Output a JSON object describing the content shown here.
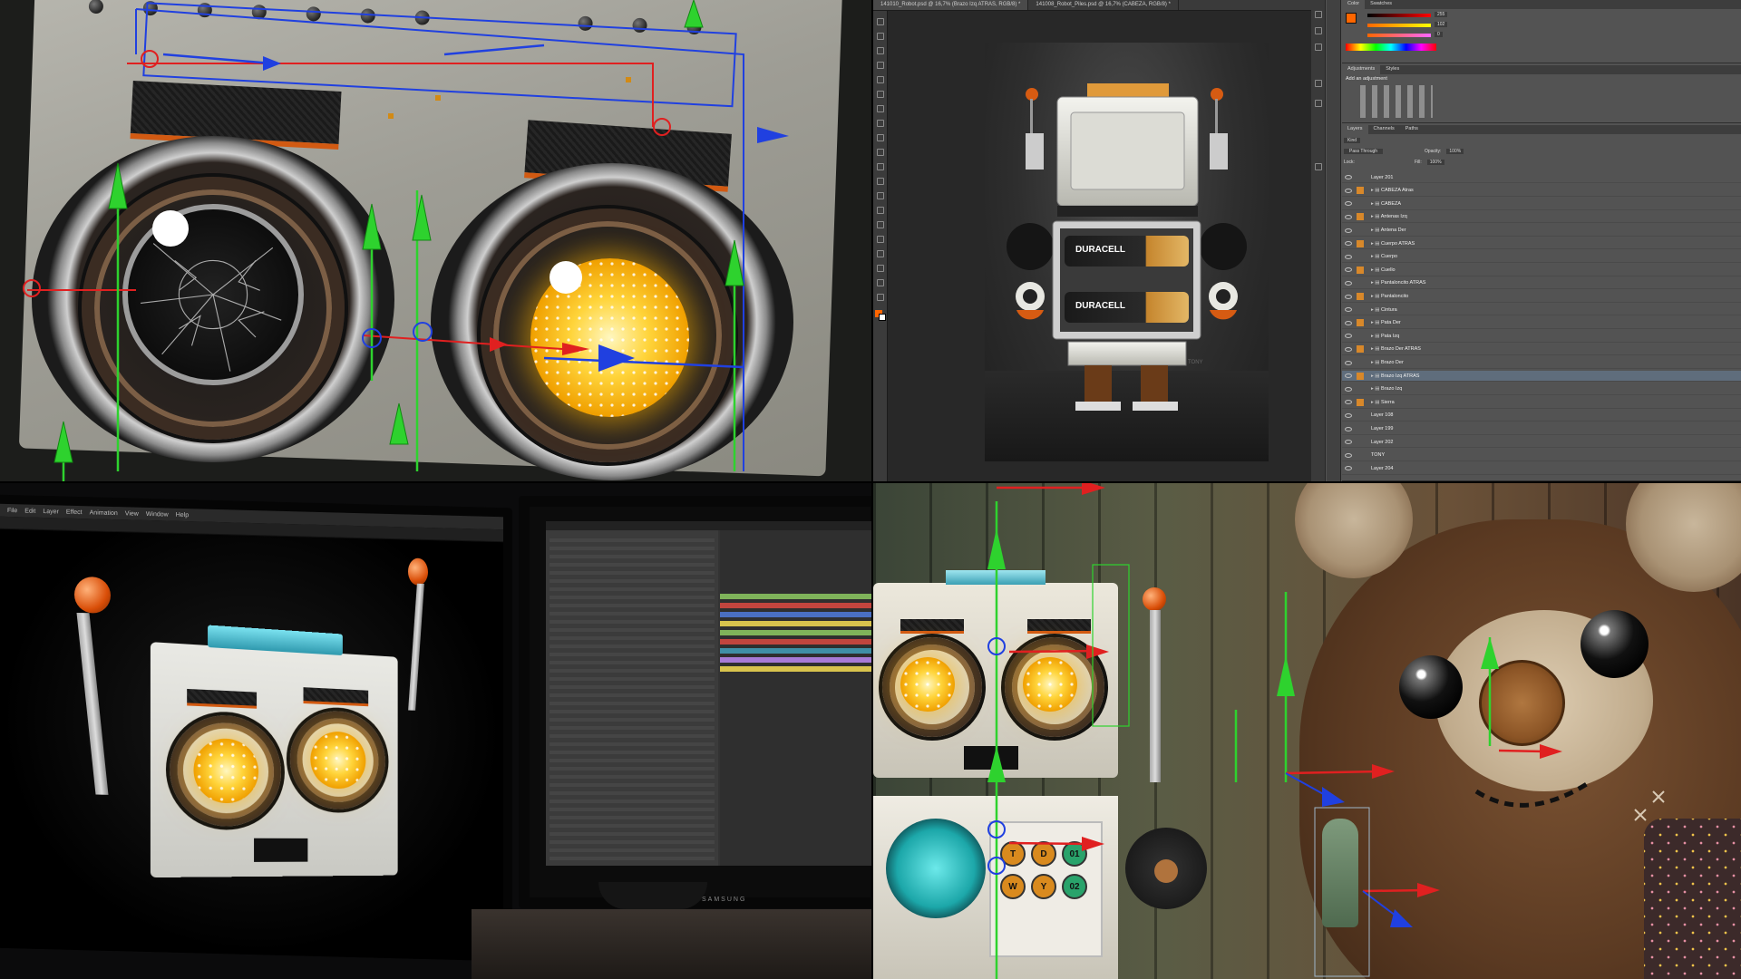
{
  "photoshop": {
    "tabs": [
      "141010_Robot.psd @ 16,7% (Brazo Izq ATRAS, RGB/8) *",
      "141008_Robot_Piles.psd @ 16,7% (CABEZA, RGB/8) *"
    ],
    "panel_tabs_top": [
      "Color",
      "Swatches"
    ],
    "panel_tabs_adjust": [
      "Adjustments",
      "Styles"
    ],
    "adjust_title": "Add an adjustment",
    "panel_tabs_layers": [
      "Layers",
      "Channels",
      "Paths"
    ],
    "color_values": [
      "255",
      "102",
      "0"
    ],
    "blend_mode": "Pass Through",
    "opacity_label": "Opacity:",
    "opacity_value": "100%",
    "fill_label": "Fill:",
    "fill_value": "100%",
    "kind_label": "Kind",
    "lock_label": "Lock:",
    "layers": [
      {
        "name": "Layer 201",
        "type": "layer"
      },
      {
        "name": "CABEZA Atras",
        "type": "folder"
      },
      {
        "name": "CABEZA",
        "type": "folder"
      },
      {
        "name": "Antenas Izq",
        "type": "folder"
      },
      {
        "name": "Antena Der",
        "type": "folder"
      },
      {
        "name": "Cuerpo ATRAS",
        "type": "folder"
      },
      {
        "name": "Cuerpo",
        "type": "folder"
      },
      {
        "name": "Cuello",
        "type": "folder"
      },
      {
        "name": "Pantaloncito ATRAS",
        "type": "folder"
      },
      {
        "name": "Pantaloncito",
        "type": "folder"
      },
      {
        "name": "Cintura",
        "type": "folder"
      },
      {
        "name": "Pata Der",
        "type": "folder"
      },
      {
        "name": "Pata Izq",
        "type": "folder"
      },
      {
        "name": "Brazo Der ATRAS",
        "type": "folder"
      },
      {
        "name": "Brazo Der",
        "type": "folder"
      },
      {
        "name": "Brazo Izq ATRAS",
        "type": "folder",
        "selected": true
      },
      {
        "name": "Brazo Izq",
        "type": "folder"
      },
      {
        "name": "Sierra",
        "type": "folder"
      },
      {
        "name": "Layer 108",
        "type": "layer"
      },
      {
        "name": "Layer 199",
        "type": "layer"
      },
      {
        "name": "Layer 202",
        "type": "layer"
      },
      {
        "name": "TONY",
        "type": "text"
      },
      {
        "name": "Layer 204",
        "type": "layer"
      }
    ],
    "artboard": {
      "battery_labels": [
        "DURACELL",
        "DURACELL"
      ],
      "signature": "TONY"
    }
  },
  "monitors": {
    "left_menu": [
      "File",
      "Edit",
      "Layer",
      "Effect",
      "Animation",
      "View",
      "Window",
      "Help"
    ],
    "right_brand": "SAMSUNG",
    "timeline_colors": [
      "#7fb35a",
      "#c2453e",
      "#4a6fc2",
      "#d8c34d",
      "#7fb35a",
      "#c2453e",
      "#3f8fa6",
      "#a77ad6",
      "#d8c34d"
    ]
  },
  "scene": {
    "buttons": [
      "T",
      "D",
      "01",
      "W",
      "Y",
      "02"
    ],
    "button_colors": [
      "#d98a1e",
      "#d98a1e",
      "#29a36b",
      "#d98a1e",
      "#d98a1e",
      "#29a36b"
    ]
  },
  "colors": {
    "led": "#ffc21a",
    "brow_accent": "#d25a12",
    "gizmo_green": "#2ed22e",
    "gizmo_red": "#e02020",
    "gizmo_blue": "#2040e0",
    "ps_selected": "#5f6d7c"
  }
}
